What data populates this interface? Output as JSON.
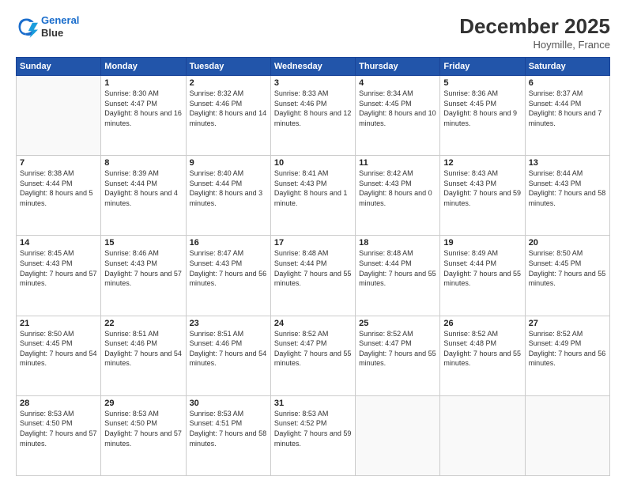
{
  "logo": {
    "line1": "General",
    "line2": "Blue"
  },
  "title": "December 2025",
  "location": "Hoymille, France",
  "days_header": [
    "Sunday",
    "Monday",
    "Tuesday",
    "Wednesday",
    "Thursday",
    "Friday",
    "Saturday"
  ],
  "weeks": [
    [
      {
        "num": "",
        "info": ""
      },
      {
        "num": "1",
        "info": "Sunrise: 8:30 AM\nSunset: 4:47 PM\nDaylight: 8 hours\nand 16 minutes."
      },
      {
        "num": "2",
        "info": "Sunrise: 8:32 AM\nSunset: 4:46 PM\nDaylight: 8 hours\nand 14 minutes."
      },
      {
        "num": "3",
        "info": "Sunrise: 8:33 AM\nSunset: 4:46 PM\nDaylight: 8 hours\nand 12 minutes."
      },
      {
        "num": "4",
        "info": "Sunrise: 8:34 AM\nSunset: 4:45 PM\nDaylight: 8 hours\nand 10 minutes."
      },
      {
        "num": "5",
        "info": "Sunrise: 8:36 AM\nSunset: 4:45 PM\nDaylight: 8 hours\nand 9 minutes."
      },
      {
        "num": "6",
        "info": "Sunrise: 8:37 AM\nSunset: 4:44 PM\nDaylight: 8 hours\nand 7 minutes."
      }
    ],
    [
      {
        "num": "7",
        "info": "Sunrise: 8:38 AM\nSunset: 4:44 PM\nDaylight: 8 hours\nand 5 minutes."
      },
      {
        "num": "8",
        "info": "Sunrise: 8:39 AM\nSunset: 4:44 PM\nDaylight: 8 hours\nand 4 minutes."
      },
      {
        "num": "9",
        "info": "Sunrise: 8:40 AM\nSunset: 4:44 PM\nDaylight: 8 hours\nand 3 minutes."
      },
      {
        "num": "10",
        "info": "Sunrise: 8:41 AM\nSunset: 4:43 PM\nDaylight: 8 hours\nand 1 minute."
      },
      {
        "num": "11",
        "info": "Sunrise: 8:42 AM\nSunset: 4:43 PM\nDaylight: 8 hours\nand 0 minutes."
      },
      {
        "num": "12",
        "info": "Sunrise: 8:43 AM\nSunset: 4:43 PM\nDaylight: 7 hours\nand 59 minutes."
      },
      {
        "num": "13",
        "info": "Sunrise: 8:44 AM\nSunset: 4:43 PM\nDaylight: 7 hours\nand 58 minutes."
      }
    ],
    [
      {
        "num": "14",
        "info": "Sunrise: 8:45 AM\nSunset: 4:43 PM\nDaylight: 7 hours\nand 57 minutes."
      },
      {
        "num": "15",
        "info": "Sunrise: 8:46 AM\nSunset: 4:43 PM\nDaylight: 7 hours\nand 57 minutes."
      },
      {
        "num": "16",
        "info": "Sunrise: 8:47 AM\nSunset: 4:43 PM\nDaylight: 7 hours\nand 56 minutes."
      },
      {
        "num": "17",
        "info": "Sunrise: 8:48 AM\nSunset: 4:44 PM\nDaylight: 7 hours\nand 55 minutes."
      },
      {
        "num": "18",
        "info": "Sunrise: 8:48 AM\nSunset: 4:44 PM\nDaylight: 7 hours\nand 55 minutes."
      },
      {
        "num": "19",
        "info": "Sunrise: 8:49 AM\nSunset: 4:44 PM\nDaylight: 7 hours\nand 55 minutes."
      },
      {
        "num": "20",
        "info": "Sunrise: 8:50 AM\nSunset: 4:45 PM\nDaylight: 7 hours\nand 55 minutes."
      }
    ],
    [
      {
        "num": "21",
        "info": "Sunrise: 8:50 AM\nSunset: 4:45 PM\nDaylight: 7 hours\nand 54 minutes."
      },
      {
        "num": "22",
        "info": "Sunrise: 8:51 AM\nSunset: 4:46 PM\nDaylight: 7 hours\nand 54 minutes."
      },
      {
        "num": "23",
        "info": "Sunrise: 8:51 AM\nSunset: 4:46 PM\nDaylight: 7 hours\nand 54 minutes."
      },
      {
        "num": "24",
        "info": "Sunrise: 8:52 AM\nSunset: 4:47 PM\nDaylight: 7 hours\nand 55 minutes."
      },
      {
        "num": "25",
        "info": "Sunrise: 8:52 AM\nSunset: 4:47 PM\nDaylight: 7 hours\nand 55 minutes."
      },
      {
        "num": "26",
        "info": "Sunrise: 8:52 AM\nSunset: 4:48 PM\nDaylight: 7 hours\nand 55 minutes."
      },
      {
        "num": "27",
        "info": "Sunrise: 8:52 AM\nSunset: 4:49 PM\nDaylight: 7 hours\nand 56 minutes."
      }
    ],
    [
      {
        "num": "28",
        "info": "Sunrise: 8:53 AM\nSunset: 4:50 PM\nDaylight: 7 hours\nand 57 minutes."
      },
      {
        "num": "29",
        "info": "Sunrise: 8:53 AM\nSunset: 4:50 PM\nDaylight: 7 hours\nand 57 minutes."
      },
      {
        "num": "30",
        "info": "Sunrise: 8:53 AM\nSunset: 4:51 PM\nDaylight: 7 hours\nand 58 minutes."
      },
      {
        "num": "31",
        "info": "Sunrise: 8:53 AM\nSunset: 4:52 PM\nDaylight: 7 hours\nand 59 minutes."
      },
      {
        "num": "",
        "info": ""
      },
      {
        "num": "",
        "info": ""
      },
      {
        "num": "",
        "info": ""
      }
    ]
  ]
}
